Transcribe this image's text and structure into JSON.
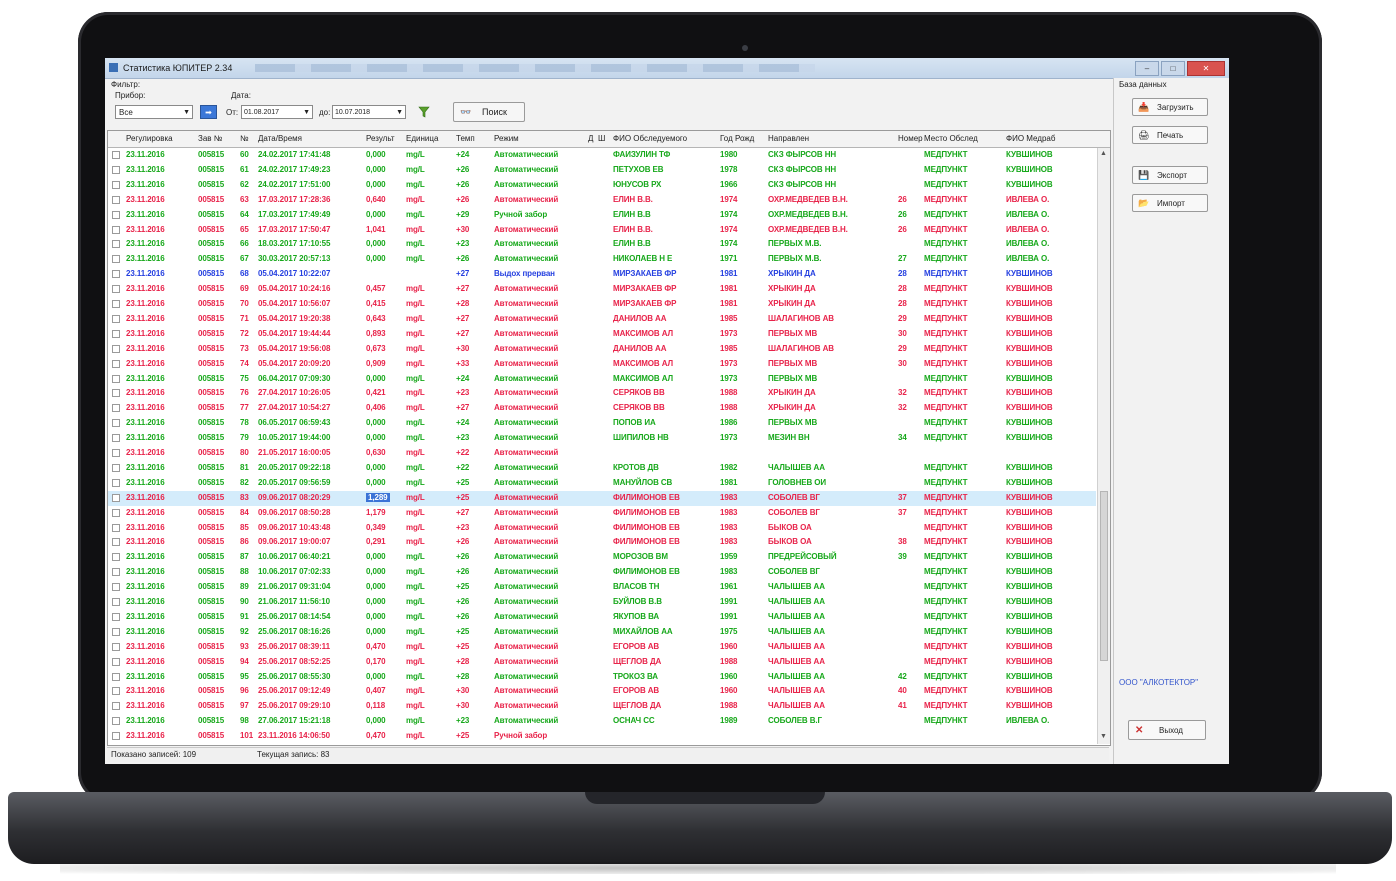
{
  "window": {
    "title": "Статистика ЮПИТЕР 2.34"
  },
  "filter": {
    "label": "Фильтр:",
    "device_label": "Прибор:",
    "device_value": "Все",
    "date_label": "Дата:",
    "from_prefix": "От:",
    "from_value": "01.08.2017",
    "to_prefix": "до:",
    "to_value": "10.07.2018",
    "search_label": "Поиск"
  },
  "table": {
    "columns": [
      "Регулировка",
      "Зав №",
      "№",
      "Дата/Время",
      "Результ",
      "Единица",
      "Темп",
      "Режим",
      "Д",
      "Ш",
      "ФИО Обследуемого",
      "Год Рожд",
      "Направлен",
      "Номер",
      "Место Обслед",
      "ФИО Медраб"
    ],
    "rows": [
      [
        "23.11.2016",
        "005815",
        "60",
        "24.02.2017 17:41:48",
        "0,000",
        "mg/L",
        "+24",
        "Автоматический",
        "ФАИЗУЛИН ТФ",
        "1980",
        "СКЗ ФЫРСОВ НН",
        "",
        "МЕДПУНКТ",
        "КУВШИНОВ"
      ],
      [
        "23.11.2016",
        "005815",
        "61",
        "24.02.2017 17:49:23",
        "0,000",
        "mg/L",
        "+26",
        "Автоматический",
        "ПЕТУХОВ ЕВ",
        "1978",
        "СКЗ ФЫРСОВ НН",
        "",
        "МЕДПУНКТ",
        "КУВШИНОВ"
      ],
      [
        "23.11.2016",
        "005815",
        "62",
        "24.02.2017 17:51:00",
        "0,000",
        "mg/L",
        "+26",
        "Автоматический",
        "ЮНУСОВ РХ",
        "1966",
        "СКЗ ФЫРСОВ НН",
        "",
        "МЕДПУНКТ",
        "КУВШИНОВ"
      ],
      [
        "23.11.2016",
        "005815",
        "63",
        "17.03.2017 17:28:36",
        "0,640",
        "mg/L",
        "+26",
        "Автоматический",
        "ЕЛИН В.В.",
        "1974",
        "ОХР.МЕДВЕДЕВ В.Н.",
        "26",
        "МЕДПУНКТ",
        "ИВЛЕВА О."
      ],
      [
        "23.11.2016",
        "005815",
        "64",
        "17.03.2017 17:49:49",
        "0,000",
        "mg/L",
        "+29",
        "Ручной забор",
        "ЕЛИН В.В",
        "1974",
        "ОХР.МЕДВЕДЕВ В.Н.",
        "26",
        "МЕДПУНКТ",
        "ИВЛЕВА О."
      ],
      [
        "23.11.2016",
        "005815",
        "65",
        "17.03.2017 17:50:47",
        "1,041",
        "mg/L",
        "+30",
        "Автоматический",
        "ЕЛИН В.В.",
        "1974",
        "ОХР.МЕДВЕДЕВ В.Н.",
        "26",
        "МЕДПУНКТ",
        "ИВЛЕВА О."
      ],
      [
        "23.11.2016",
        "005815",
        "66",
        "18.03.2017 17:10:55",
        "0,000",
        "mg/L",
        "+23",
        "Автоматический",
        "ЕЛИН В.В",
        "1974",
        "ПЕРВЫХ М.В.",
        "",
        "МЕДПУНКТ",
        "ИВЛЕВА О."
      ],
      [
        "23.11.2016",
        "005815",
        "67",
        "30.03.2017 20:57:13",
        "0,000",
        "mg/L",
        "+26",
        "Автоматический",
        "НИКОЛАЕВ Н Е",
        "1971",
        "ПЕРВЫХ М.В.",
        "27",
        "МЕДПУНКТ",
        "ИВЛЕВА О."
      ],
      [
        "23.11.2016",
        "005815",
        "68",
        "05.04.2017 10:22:07",
        "",
        "",
        "+27",
        "Выдох прерван",
        "МИРЗАКАЕВ ФР",
        "1981",
        "ХРЫКИН ДА",
        "28",
        "МЕДПУНКТ",
        "КУВШИНОВ"
      ],
      [
        "23.11.2016",
        "005815",
        "69",
        "05.04.2017 10:24:16",
        "0,457",
        "mg/L",
        "+27",
        "Автоматический",
        "МИРЗАКАЕВ ФР",
        "1981",
        "ХРЫКИН ДА",
        "28",
        "МЕДПУНКТ",
        "КУВШИНОВ"
      ],
      [
        "23.11.2016",
        "005815",
        "70",
        "05.04.2017 10:56:07",
        "0,415",
        "mg/L",
        "+28",
        "Автоматический",
        "МИРЗАКАЕВ ФР",
        "1981",
        "ХРЫКИН ДА",
        "28",
        "МЕДПУНКТ",
        "КУВШИНОВ"
      ],
      [
        "23.11.2016",
        "005815",
        "71",
        "05.04.2017 19:20:38",
        "0,643",
        "mg/L",
        "+27",
        "Автоматический",
        "ДАНИЛОВ АА",
        "1985",
        "ШАЛАГИНОВ АВ",
        "29",
        "МЕДПУНКТ",
        "КУВШИНОВ"
      ],
      [
        "23.11.2016",
        "005815",
        "72",
        "05.04.2017 19:44:44",
        "0,893",
        "mg/L",
        "+27",
        "Автоматический",
        "МАКСИМОВ АЛ",
        "1973",
        "ПЕРВЫХ МВ",
        "30",
        "МЕДПУНКТ",
        "КУВШИНОВ"
      ],
      [
        "23.11.2016",
        "005815",
        "73",
        "05.04.2017 19:56:08",
        "0,673",
        "mg/L",
        "+30",
        "Автоматический",
        "ДАНИЛОВ АА",
        "1985",
        "ШАЛАГИНОВ АВ",
        "29",
        "МЕДПУНКТ",
        "КУВШИНОВ"
      ],
      [
        "23.11.2016",
        "005815",
        "74",
        "05.04.2017 20:09:20",
        "0,909",
        "mg/L",
        "+33",
        "Автоматический",
        "МАКСИМОВ АЛ",
        "1973",
        "ПЕРВЫХ МВ",
        "30",
        "МЕДПУНКТ",
        "КУВШИНОВ"
      ],
      [
        "23.11.2016",
        "005815",
        "75",
        "06.04.2017 07:09:30",
        "0,000",
        "mg/L",
        "+24",
        "Автоматический",
        "МАКСИМОВ АЛ",
        "1973",
        "ПЕРВЫХ МВ",
        "",
        "МЕДПУНКТ",
        "КУВШИНОВ"
      ],
      [
        "23.11.2016",
        "005815",
        "76",
        "27.04.2017 10:26:05",
        "0,421",
        "mg/L",
        "+23",
        "Автоматический",
        "СЕРЯКОВ ВВ",
        "1988",
        "ХРЫКИН ДА",
        "32",
        "МЕДПУНКТ",
        "КУВШИНОВ"
      ],
      [
        "23.11.2016",
        "005815",
        "77",
        "27.04.2017 10:54:27",
        "0,406",
        "mg/L",
        "+27",
        "Автоматический",
        "СЕРЯКОВ ВВ",
        "1988",
        "ХРЫКИН ДА",
        "32",
        "МЕДПУНКТ",
        "КУВШИНОВ"
      ],
      [
        "23.11.2016",
        "005815",
        "78",
        "06.05.2017 06:59:43",
        "0,000",
        "mg/L",
        "+24",
        "Автоматический",
        "ПОПОВ ИА",
        "1986",
        "ПЕРВЫХ МВ",
        "",
        "МЕДПУНКТ",
        "КУВШИНОВ"
      ],
      [
        "23.11.2016",
        "005815",
        "79",
        "10.05.2017 19:44:00",
        "0,000",
        "mg/L",
        "+23",
        "Автоматический",
        "ШИПИЛОВ НВ",
        "1973",
        "МЕЗИН ВН",
        "34",
        "МЕДПУНКТ",
        "КУВШИНОВ"
      ],
      [
        "23.11.2016",
        "005815",
        "80",
        "21.05.2017 16:00:05",
        "0,630",
        "mg/L",
        "+22",
        "Автоматический",
        "",
        "",
        "",
        "",
        "",
        ""
      ],
      [
        "23.11.2016",
        "005815",
        "81",
        "20.05.2017 09:22:18",
        "0,000",
        "mg/L",
        "+22",
        "Автоматический",
        "КРОТОВ ДВ",
        "1982",
        "ЧАЛЫШЕВ АА",
        "",
        "МЕДПУНКТ",
        "КУВШИНОВ"
      ],
      [
        "23.11.2016",
        "005815",
        "82",
        "20.05.2017 09:56:59",
        "0,000",
        "mg/L",
        "+25",
        "Автоматический",
        "МАНУЙЛОВ СВ",
        "1981",
        "ГОЛОВНЕВ ОИ",
        "",
        "МЕДПУНКТ",
        "КУВШИНОВ"
      ],
      [
        "23.11.2016",
        "005815",
        "83",
        "09.06.2017 08:20:29",
        "1,289",
        "mg/L",
        "+25",
        "Автоматический",
        "ФИЛИМОНОВ ЕВ",
        "1983",
        "СОБОЛЕВ ВГ",
        "37",
        "МЕДПУНКТ",
        "КУВШИНОВ"
      ],
      [
        "23.11.2016",
        "005815",
        "84",
        "09.06.2017 08:50:28",
        "1,179",
        "mg/L",
        "+27",
        "Автоматический",
        "ФИЛИМОНОВ ЕВ",
        "1983",
        "СОБОЛЕВ ВГ",
        "37",
        "МЕДПУНКТ",
        "КУВШИНОВ"
      ],
      [
        "23.11.2016",
        "005815",
        "85",
        "09.06.2017 10:43:48",
        "0,349",
        "mg/L",
        "+23",
        "Автоматический",
        "ФИЛИМОНОВ ЕВ",
        "1983",
        "БЫКОВ ОА",
        "",
        "МЕДПУНКТ",
        "КУВШИНОВ"
      ],
      [
        "23.11.2016",
        "005815",
        "86",
        "09.06.2017 19:00:07",
        "0,291",
        "mg/L",
        "+26",
        "Автоматический",
        "ФИЛИМОНОВ ЕВ",
        "1983",
        "БЫКОВ ОА",
        "38",
        "МЕДПУНКТ",
        "КУВШИНОВ"
      ],
      [
        "23.11.2016",
        "005815",
        "87",
        "10.06.2017 06:40:21",
        "0,000",
        "mg/L",
        "+26",
        "Автоматический",
        "МОРОЗОВ ВМ",
        "1959",
        "ПРЕДРЕЙСОВЫЙ",
        "39",
        "МЕДПУНКТ",
        "КУВШИНОВ"
      ],
      [
        "23.11.2016",
        "005815",
        "88",
        "10.06.2017 07:02:33",
        "0,000",
        "mg/L",
        "+26",
        "Автоматический",
        "ФИЛИМОНОВ ЕВ",
        "1983",
        "СОБОЛЕВ ВГ",
        "",
        "МЕДПУНКТ",
        "КУВШИНОВ"
      ],
      [
        "23.11.2016",
        "005815",
        "89",
        "21.06.2017 09:31:04",
        "0,000",
        "mg/L",
        "+25",
        "Автоматический",
        "ВЛАСОВ ТН",
        "1961",
        "ЧАЛЫШЕВ АА",
        "",
        "МЕДПУНКТ",
        "КУВШИНОВ"
      ],
      [
        "23.11.2016",
        "005815",
        "90",
        "21.06.2017 11:56:10",
        "0,000",
        "mg/L",
        "+26",
        "Автоматический",
        "БУЙЛОВ В.В",
        "1991",
        "ЧАЛЫШЕВ АА",
        "",
        "МЕДПУНКТ",
        "КУВШИНОВ"
      ],
      [
        "23.11.2016",
        "005815",
        "91",
        "25.06.2017 08:14:54",
        "0,000",
        "mg/L",
        "+26",
        "Автоматический",
        "ЯКУПОВ ВА",
        "1991",
        "ЧАЛЫШЕВ АА",
        "",
        "МЕДПУНКТ",
        "КУВШИНОВ"
      ],
      [
        "23.11.2016",
        "005815",
        "92",
        "25.06.2017 08:16:26",
        "0,000",
        "mg/L",
        "+25",
        "Автоматический",
        "МИХАЙЛОВ АА",
        "1975",
        "ЧАЛЫШЕВ АА",
        "",
        "МЕДПУНКТ",
        "КУВШИНОВ"
      ],
      [
        "23.11.2016",
        "005815",
        "93",
        "25.06.2017 08:39:11",
        "0,470",
        "mg/L",
        "+25",
        "Автоматический",
        "ЕГОРОВ АВ",
        "1960",
        "ЧАЛЫШЕВ АА",
        "",
        "МЕДПУНКТ",
        "КУВШИНОВ"
      ],
      [
        "23.11.2016",
        "005815",
        "94",
        "25.06.2017 08:52:25",
        "0,170",
        "mg/L",
        "+28",
        "Автоматический",
        "ЩЕГЛОВ ДА",
        "1988",
        "ЧАЛЫШЕВ АА",
        "",
        "МЕДПУНКТ",
        "КУВШИНОВ"
      ],
      [
        "23.11.2016",
        "005815",
        "95",
        "25.06.2017 08:55:30",
        "0,000",
        "mg/L",
        "+28",
        "Автоматический",
        "ТРОКОЗ ВА",
        "1960",
        "ЧАЛЫШЕВ АА",
        "42",
        "МЕДПУНКТ",
        "КУВШИНОВ"
      ],
      [
        "23.11.2016",
        "005815",
        "96",
        "25.06.2017 09:12:49",
        "0,407",
        "mg/L",
        "+30",
        "Автоматический",
        "ЕГОРОВ АВ",
        "1960",
        "ЧАЛЫШЕВ АА",
        "40",
        "МЕДПУНКТ",
        "КУВШИНОВ"
      ],
      [
        "23.11.2016",
        "005815",
        "97",
        "25.06.2017 09:29:10",
        "0,118",
        "mg/L",
        "+30",
        "Автоматический",
        "ЩЕГЛОВ ДА",
        "1988",
        "ЧАЛЫШЕВ АА",
        "41",
        "МЕДПУНКТ",
        "КУВШИНОВ"
      ],
      [
        "23.11.2016",
        "005815",
        "98",
        "27.06.2017 15:21:18",
        "0,000",
        "mg/L",
        "+23",
        "Автоматический",
        "ОСНАЧ СС",
        "1989",
        "СОБОЛЕВ В.Г",
        "",
        "МЕДПУНКТ",
        "ИВЛЕВА О."
      ],
      [
        "23.11.2016",
        "005815",
        "101",
        "23.11.2016 14:06:50",
        "0,470",
        "mg/L",
        "+25",
        "Ручной забор",
        "",
        "",
        "",
        "",
        "",
        ""
      ]
    ],
    "row_colors": [
      "green",
      "green",
      "green",
      "red",
      "green",
      "red",
      "green",
      "green",
      "blue",
      "red",
      "red",
      "red",
      "red",
      "red",
      "red",
      "green",
      "red",
      "red",
      "green",
      "green",
      "red",
      "green",
      "green",
      "red",
      "red",
      "red",
      "red",
      "green",
      "green",
      "green",
      "green",
      "green",
      "green",
      "red",
      "red",
      "green",
      "red",
      "red",
      "green",
      "red"
    ],
    "current_row": 23
  },
  "status": {
    "shown": "Показано записей: 109",
    "current": "Текущая запись: 83"
  },
  "sidebar": {
    "title": "База данных",
    "load_label": "Загрузить",
    "print_label": "Печать",
    "export_label": "Экспорт",
    "import_label": "Импорт",
    "company": "ООО \"АЛКОТЕКТОР\"",
    "exit_label": "Выход"
  },
  "colors": {
    "green": "#17a81b",
    "red": "#e8234a",
    "blue": "#2540e0",
    "accent": "#3b73d6"
  },
  "icons": [
    "funnel-icon",
    "binoculars-icon",
    "load-icon",
    "print-icon",
    "floppy-icon",
    "import-icon",
    "close-icon",
    "arrow-right-icon"
  ]
}
